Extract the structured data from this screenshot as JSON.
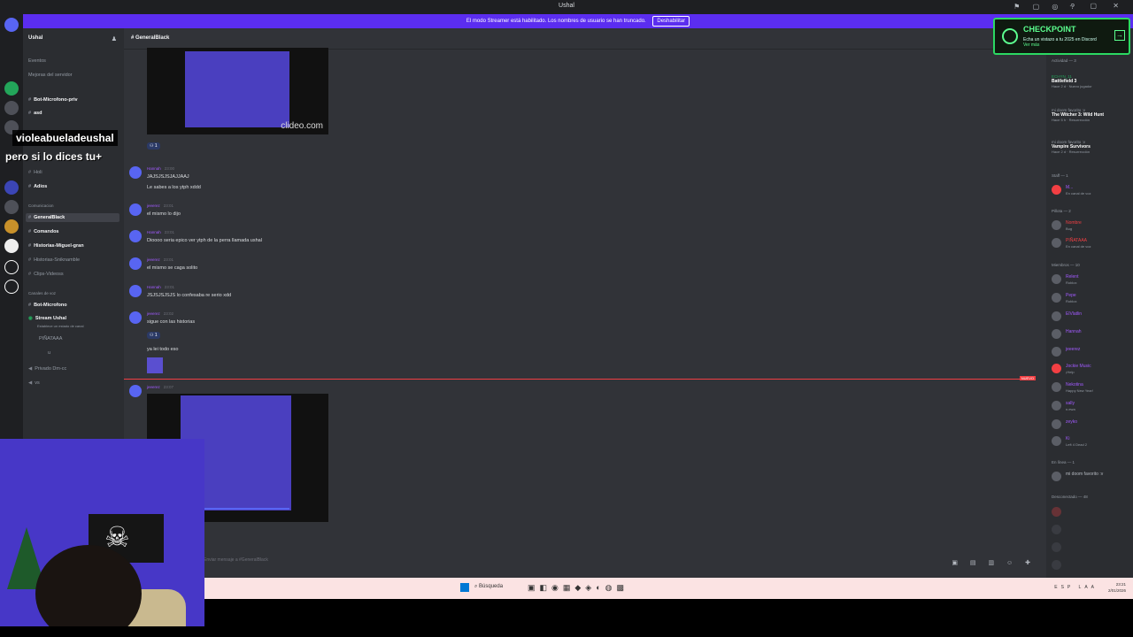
{
  "window": {
    "title": "Ushal"
  },
  "banner": {
    "text": "El modo Streamer está habilitado. Los nombres de usuario se han truncado.",
    "button": "Deshabilitar"
  },
  "server": {
    "name": "Ushal"
  },
  "sidebar": {
    "top_items": [
      "Eventos",
      "Mejoras del servidor"
    ],
    "channels": [
      "Bot-Microfono-priv",
      "asd",
      "Holi",
      "Adios"
    ],
    "category_comunicacion": "Comunicacion",
    "active_channel": "GeneralBlack",
    "channels2": [
      "Comandos",
      "Historias-Miguel-gran",
      "Historias-Sniknamble",
      "Clips-Videoss"
    ],
    "category_voice": "Canales de voz",
    "voice": [
      "Bot-Microfono",
      "Stream Ushal"
    ],
    "voice_status": "Establece un estado de canal",
    "voice_users": [
      "PIÑATAAA",
      "u"
    ],
    "bottom": [
      "Privado Dm-cc",
      "vs"
    ]
  },
  "overlay": {
    "username": "violeabueladeushal",
    "message": "pero si lo dices tu+"
  },
  "chat": {
    "channel": "GeneralBlack",
    "messages": [
      {
        "author": "Hannah",
        "time": "23:00",
        "text": "JAJSJSJSJAJJAAJ"
      },
      {
        "author": "",
        "time": "",
        "text": "Le sabes a los ytph xddd"
      },
      {
        "author": "jeeerez",
        "time": "23:01",
        "text": "el mismo lo dijo"
      },
      {
        "author": "Hannah",
        "time": "23:01",
        "text": "Dioooo seria epico ver ytph de la perra llamada ushal"
      },
      {
        "author": "jeeerez",
        "time": "23:01",
        "text": "el mismo se caga solito"
      },
      {
        "author": "Hannah",
        "time": "23:01",
        "text": "JSJSJSJSJS lo confesaba re serio xdd"
      },
      {
        "author": "jeeerez",
        "time": "23:02",
        "text": "sigue con las historias"
      },
      {
        "author": "",
        "time": "",
        "text": "ya lei todo eso"
      },
      {
        "author": "jeeerez",
        "time": "23:07",
        "text": ""
      }
    ],
    "reaction_count": "1",
    "watermark": "clideo.com",
    "new_label": "NUEVO",
    "composer_placeholder": "Enviar mensaje a #GeneralBlack"
  },
  "checkpoint": {
    "title": "CHECKPOINT",
    "desc": "Echa un vistazo a tu 2025 en Discord",
    "link": "Ver más"
  },
  "members": {
    "activity_header": "Actividad — 3",
    "activities": [
      {
        "user": "ECHYN_11",
        "game": "Battlefield 3",
        "status": "Hace 2 d · Nuevo jugador"
      },
      {
        "user": "mi doom favorito :v",
        "game": "The Witcher 3: Wild Hunt",
        "status": "Hace 5 h · Resurrección"
      },
      {
        "user": "mi doom favorito :v",
        "game": "Vampire Survivors",
        "status": "Hace 2 d · Resurrección"
      }
    ],
    "staff_header": "Staff — 1",
    "staff": [
      {
        "name": "M...",
        "status": "En canal de voz"
      }
    ],
    "pillota_header": "Pillota — 2",
    "pillota": [
      {
        "name": "Nombre",
        "status": "Bug"
      },
      {
        "name": "PIÑATAAA",
        "status": "En canal de voz"
      }
    ],
    "members_header": "Miembros — 10",
    "list": [
      {
        "name": "Relent",
        "status": "Roblox"
      },
      {
        "name": "Pepe",
        "status": "Roblox"
      },
      {
        "name": "ElVlatlin",
        "status": ""
      },
      {
        "name": "Hannah",
        "status": ""
      },
      {
        "name": "jeeerez",
        "status": ""
      },
      {
        "name": "Jockie Music",
        "status": "¡Help"
      },
      {
        "name": "Nekotina",
        "status": "Happy New Year!"
      },
      {
        "name": "sally",
        "status": "n.ewa"
      },
      {
        "name": "zeyko",
        "status": ""
      },
      {
        "name": "Ki",
        "status": "Left 4 Dead 2"
      }
    ],
    "online_header": "En línea — 1",
    "online": [
      {
        "name": "mi doom favorito :v",
        "status": ""
      }
    ],
    "offline_header": "Desconectado — 48"
  },
  "taskbar": {
    "search": "Búsqueda",
    "time": "23:21",
    "date": "2/01/2026",
    "lang": "ESP LAA"
  }
}
